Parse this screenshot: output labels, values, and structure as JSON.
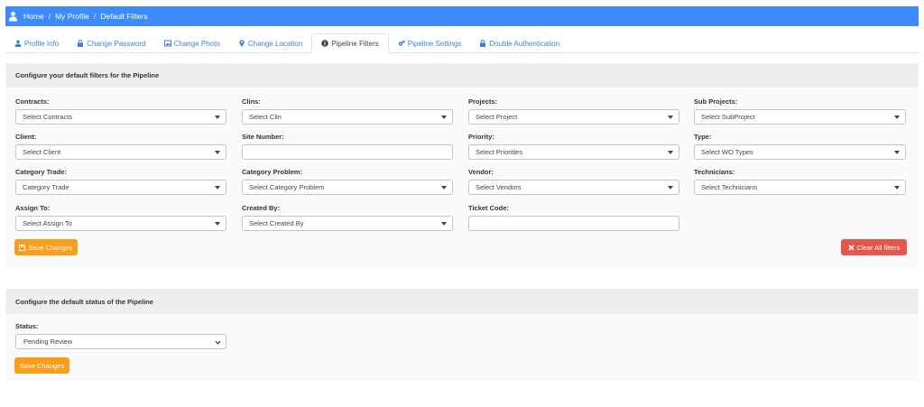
{
  "breadcrumb": {
    "items": [
      "Home",
      "My Profile",
      "Default Filters"
    ],
    "separator": "/"
  },
  "tabs": [
    {
      "label": "Profile Info",
      "icon": "user-icon"
    },
    {
      "label": "Change Password",
      "icon": "lock-icon"
    },
    {
      "label": "Change Photo",
      "icon": "image-icon"
    },
    {
      "label": "Change Location",
      "icon": "map-marker-icon"
    },
    {
      "label": "Pipeline Filters",
      "icon": "info-circle-icon",
      "active": true
    },
    {
      "label": "Pipeline Settings",
      "icon": "gears-icon"
    },
    {
      "label": "Double Authentication",
      "icon": "lock-icon"
    }
  ],
  "filters_panel": {
    "title": "Configure your default filters for the Pipeline",
    "fields": {
      "contracts": {
        "label": "Contracts:",
        "placeholder": "Select Contracts"
      },
      "clins": {
        "label": "Clins:",
        "placeholder": "Select Clin"
      },
      "projects": {
        "label": "Projects:",
        "placeholder": "Select Project"
      },
      "sub_projects": {
        "label": "Sub Projects:",
        "placeholder": "Select SubProject"
      },
      "client": {
        "label": "Client:",
        "placeholder": "Select Client"
      },
      "site_number": {
        "label": "Site Number:",
        "value": ""
      },
      "priority": {
        "label": "Priority:",
        "placeholder": "Select Priorities"
      },
      "type": {
        "label": "Type:",
        "placeholder": "Select WO Types"
      },
      "category_trade": {
        "label": "Category Trade:",
        "placeholder": "Category Trade"
      },
      "category_problem": {
        "label": "Category Problem:",
        "placeholder": "Select Category Problem"
      },
      "vendor": {
        "label": "Vendor:",
        "placeholder": "Select Vendors"
      },
      "technicians": {
        "label": "Technicians:",
        "placeholder": "Select Technicians"
      },
      "assign_to": {
        "label": "Assign To:",
        "placeholder": "Select Assign To"
      },
      "created_by": {
        "label": "Created By:",
        "placeholder": "Select Created By"
      },
      "ticket_code": {
        "label": "Ticket Code:",
        "value": ""
      }
    },
    "save_label": "Save Changes",
    "clear_label": "Clear All filters"
  },
  "status_panel": {
    "title": "Configure the default status of the Pipeline",
    "status_label": "Status:",
    "status_value": "Pending Review",
    "save_label": "Save Changes"
  },
  "colors": {
    "breadcrumb_bg": "#3d8bfd",
    "tab_link": "#3f7fd8",
    "save_button": "#f99d1c",
    "clear_button": "#e4574a"
  }
}
